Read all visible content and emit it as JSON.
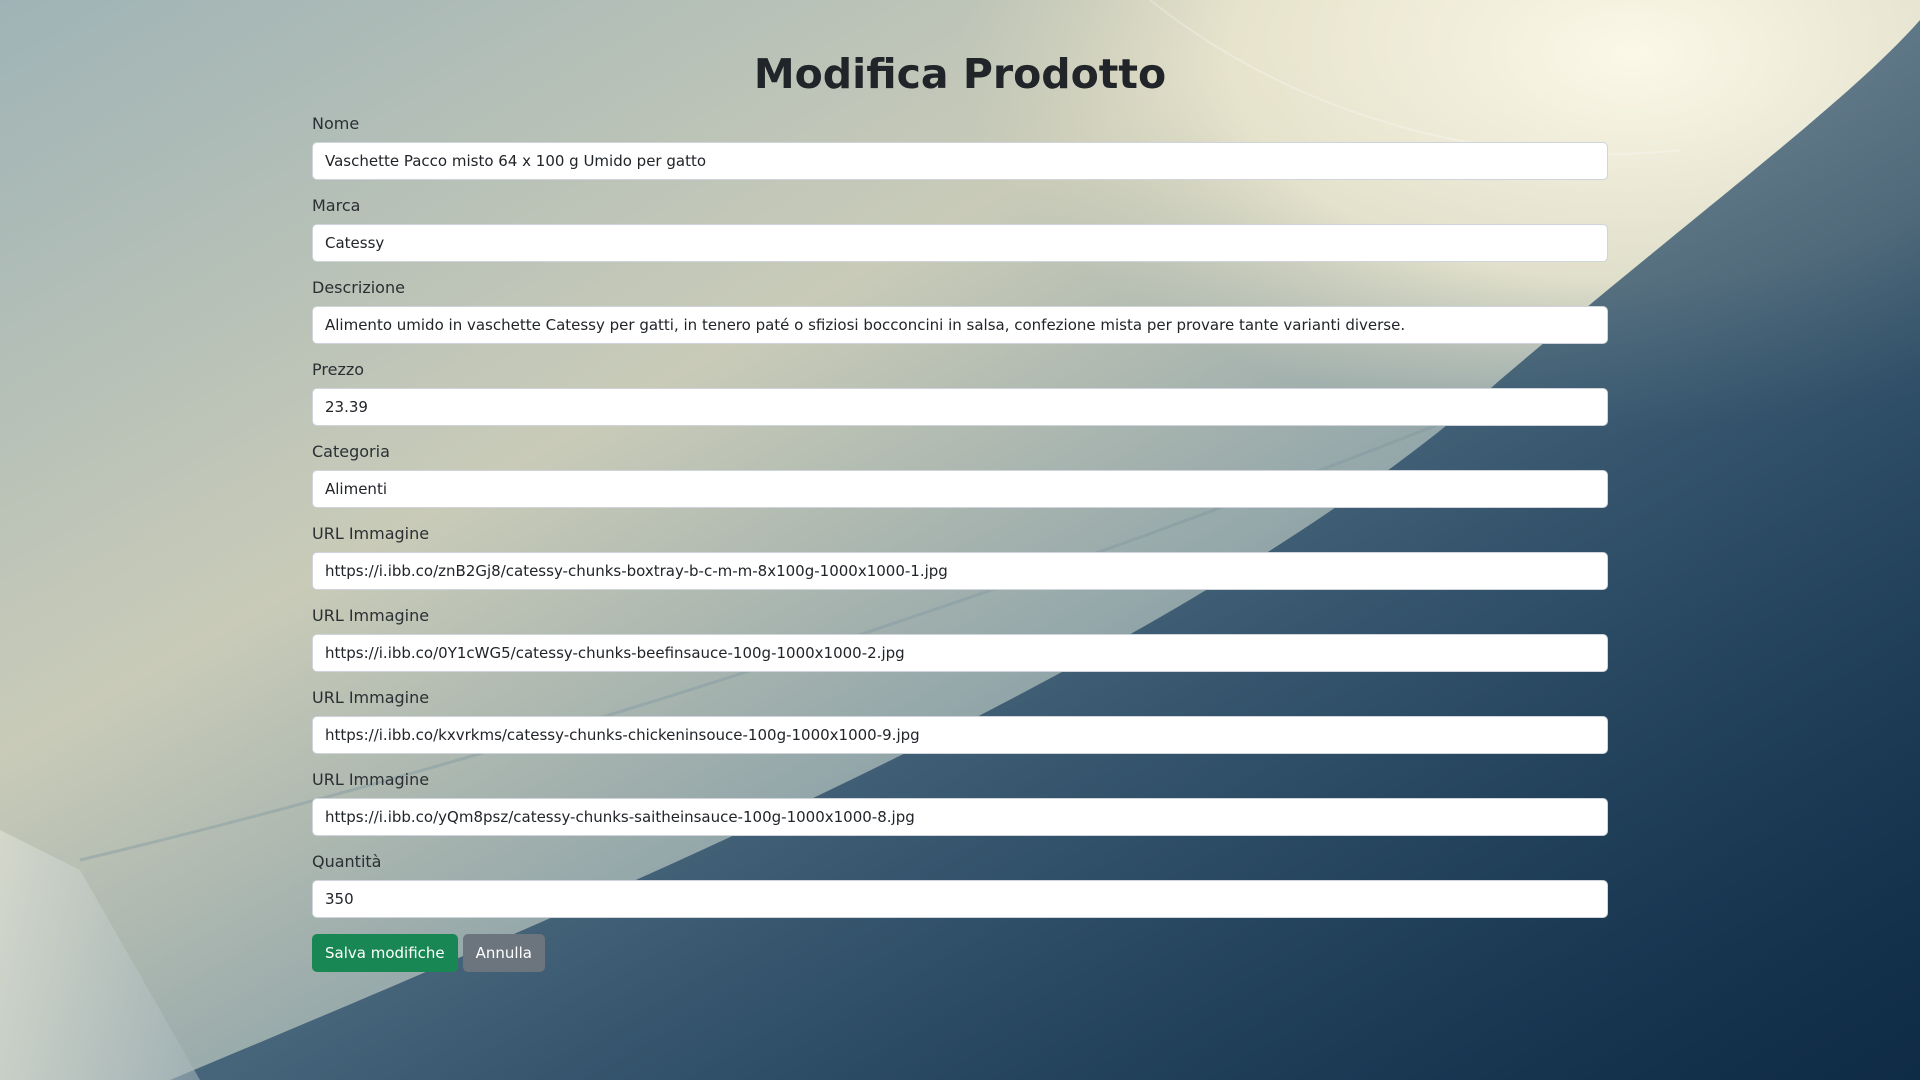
{
  "page": {
    "title": "Modifica Prodotto"
  },
  "form": {
    "nome": {
      "label": "Nome",
      "value": "Vaschette Pacco misto 64 x 100 g Umido per gatto"
    },
    "marca": {
      "label": "Marca",
      "value": "Catessy"
    },
    "descrizione": {
      "label": "Descrizione",
      "value": "Alimento umido in vaschette Catessy per gatti, in tenero paté o sfiziosi bocconcini in salsa, confezione mista per provare tante varianti diverse."
    },
    "prezzo": {
      "label": "Prezzo",
      "value": "23.39"
    },
    "categoria": {
      "label": "Categoria",
      "value": "Alimenti"
    },
    "immagini": [
      {
        "label": "URL Immagine",
        "value": "https://i.ibb.co/znB2Gj8/catessy-chunks-boxtray-b-c-m-m-8x100g-1000x1000-1.jpg"
      },
      {
        "label": "URL Immagine",
        "value": "https://i.ibb.co/0Y1cWG5/catessy-chunks-beefinsauce-100g-1000x1000-2.jpg"
      },
      {
        "label": "URL Immagine",
        "value": "https://i.ibb.co/kxvrkms/catessy-chunks-chickeninsouce-100g-1000x1000-9.jpg"
      },
      {
        "label": "URL Immagine",
        "value": "https://i.ibb.co/yQm8psz/catessy-chunks-saitheinsauce-100g-1000x1000-8.jpg"
      }
    ],
    "quantita": {
      "label": "Quantità",
      "value": "350"
    }
  },
  "buttons": {
    "save_label": "Salva modifiche",
    "cancel_label": "Annulla"
  },
  "colors": {
    "success": "#198754",
    "secondary": "#6c757d",
    "background_light": "#f3f0dc",
    "background_dark": "#15324d"
  }
}
